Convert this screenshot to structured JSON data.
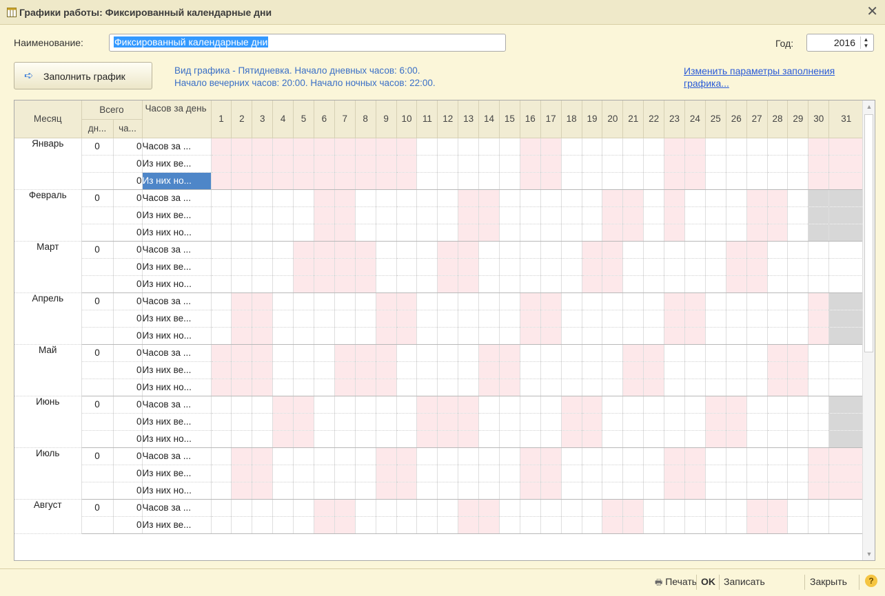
{
  "window": {
    "title": "Графики работы: Фиксированный календарные дни",
    "close": "✕"
  },
  "form": {
    "name_label": "Наименование:",
    "name_value": "Фиксированный календарные дни",
    "year_label": "Год:",
    "year_value": "2016",
    "fill_button": "Заполнить график",
    "info_line1": "Вид графика - Пятидневка. Начало дневных часов: 6:00.",
    "info_line2": "Начало вечерних часов: 20:00. Начало ночных часов: 22:00.",
    "change_link": "Изменить параметры заполнения графика..."
  },
  "table": {
    "headers": {
      "month": "Месяц",
      "total": "Всего",
      "days_short": "дн...",
      "hours_short": "ча...",
      "hours_per_day": "Часов за день"
    },
    "days": [
      "1",
      "2",
      "3",
      "4",
      "5",
      "6",
      "7",
      "8",
      "9",
      "10",
      "11",
      "12",
      "13",
      "14",
      "15",
      "16",
      "17",
      "18",
      "19",
      "20",
      "21",
      "22",
      "23",
      "24",
      "25",
      "26",
      "27",
      "28",
      "29",
      "30",
      "31"
    ],
    "row_labels": [
      "Часов за ...",
      "Из них ве...",
      "Из них но..."
    ],
    "months": [
      {
        "name": "Январь",
        "days": "0",
        "hours": [
          "0",
          "0",
          "0"
        ],
        "weekends": [
          1,
          2,
          3,
          4,
          5,
          6,
          7,
          8,
          9,
          10,
          16,
          17,
          23,
          24,
          30,
          31
        ],
        "na": []
      },
      {
        "name": "Февраль",
        "days": "0",
        "hours": [
          "0",
          "0",
          "0"
        ],
        "weekends": [
          6,
          7,
          13,
          14,
          20,
          21,
          23,
          27,
          28
        ],
        "na": [
          30,
          31
        ]
      },
      {
        "name": "Март",
        "days": "0",
        "hours": [
          "0",
          "0",
          "0"
        ],
        "weekends": [
          5,
          6,
          7,
          8,
          12,
          13,
          19,
          20,
          26,
          27
        ],
        "na": []
      },
      {
        "name": "Апрель",
        "days": "0",
        "hours": [
          "0",
          "0",
          "0"
        ],
        "weekends": [
          2,
          3,
          9,
          10,
          16,
          17,
          23,
          24,
          30
        ],
        "na": [
          31
        ]
      },
      {
        "name": "Май",
        "days": "0",
        "hours": [
          "0",
          "0",
          "0"
        ],
        "weekends": [
          1,
          2,
          3,
          7,
          8,
          9,
          14,
          15,
          21,
          22,
          28,
          29
        ],
        "na": []
      },
      {
        "name": "Июнь",
        "days": "0",
        "hours": [
          "0",
          "0",
          "0"
        ],
        "weekends": [
          4,
          5,
          11,
          12,
          13,
          18,
          19,
          25,
          26
        ],
        "na": [
          31
        ]
      },
      {
        "name": "Июль",
        "days": "0",
        "hours": [
          "0",
          "0",
          "0"
        ],
        "weekends": [
          2,
          3,
          9,
          10,
          16,
          17,
          23,
          24,
          30,
          31
        ],
        "na": []
      },
      {
        "name": "Август",
        "days": "0",
        "hours": [
          "0",
          "0"
        ],
        "weekends": [
          6,
          7,
          13,
          14,
          20,
          21,
          27,
          28
        ],
        "na": []
      }
    ],
    "selected_row_label": "Из них но..."
  },
  "footer": {
    "print": "Печать",
    "ok": "OK",
    "save": "Записать",
    "close": "Закрыть",
    "help": "?"
  },
  "colors": {
    "weekend": "#fde8ea",
    "unavailable": "#d7d7d7",
    "link": "#2a5bd7",
    "info": "#3a6fc6"
  }
}
